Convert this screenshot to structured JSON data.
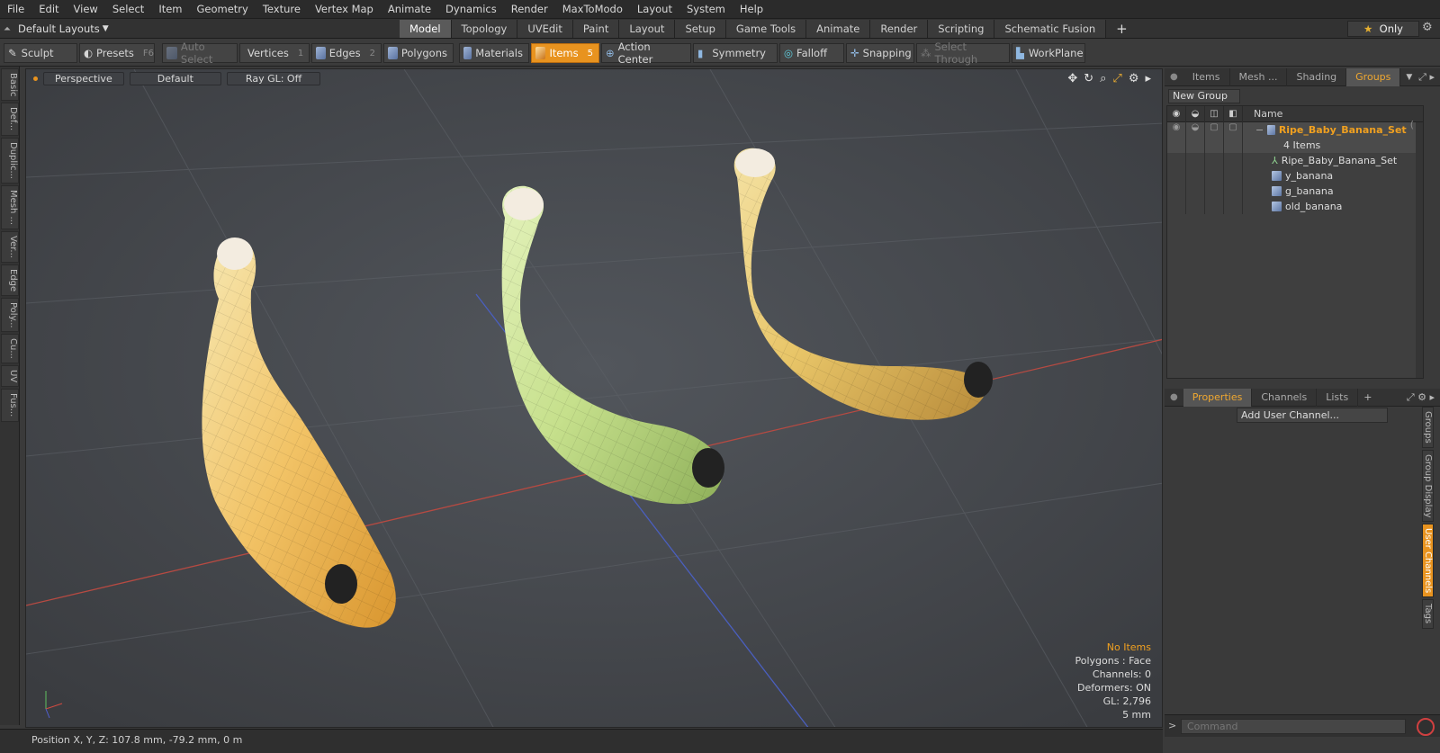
{
  "menu": [
    "File",
    "Edit",
    "View",
    "Select",
    "Item",
    "Geometry",
    "Texture",
    "Vertex Map",
    "Animate",
    "Dynamics",
    "Render",
    "MaxToModo",
    "Layout",
    "System",
    "Help"
  ],
  "layout_selector": "Default Layouts",
  "mode_tabs": [
    {
      "label": "Model",
      "active": true
    },
    {
      "label": "Topology"
    },
    {
      "label": "UVEdit"
    },
    {
      "label": "Paint"
    },
    {
      "label": "Layout"
    },
    {
      "label": "Setup"
    },
    {
      "label": "Game Tools"
    },
    {
      "label": "Animate"
    },
    {
      "label": "Render"
    },
    {
      "label": "Scripting"
    },
    {
      "label": "Schematic Fusion"
    }
  ],
  "only_label": "Only",
  "toolbar": {
    "sculpt": "Sculpt",
    "presets": "Presets",
    "presets_key": "F6",
    "auto_select": "Auto Select",
    "vertices": "Vertices",
    "vertices_key": "1",
    "edges": "Edges",
    "edges_key": "2",
    "polygons": "Polygons",
    "materials": "Materials",
    "items": "Items",
    "items_key": "5",
    "action_center": "Action Center",
    "symmetry": "Symmetry",
    "falloff": "Falloff",
    "snapping": "Snapping",
    "select_through": "Select Through",
    "workplane": "WorkPlane"
  },
  "left_tabs": [
    "Basic",
    "Def...",
    "Duplic...",
    "Mesh ...",
    "Ver...",
    "Edge",
    "Poly...",
    "Cu...",
    "UV",
    "Fus..."
  ],
  "viewport": {
    "view": "Perspective",
    "shading": "Default",
    "raygl": "Ray GL: Off",
    "info": {
      "status": "No Items",
      "polygons": "Polygons : Face",
      "channels": "Channels: 0",
      "deformers": "Deformers: ON",
      "gl": "GL: 2,796",
      "scale": "5 mm"
    }
  },
  "status_bar": "Position X, Y, Z:   107.8 mm, -79.2 mm, 0 m",
  "groups_panel": {
    "tabs": [
      "Items",
      "Mesh ...",
      "Shading",
      "Groups"
    ],
    "new_group": "New Group",
    "name_col": "Name",
    "group_name": "Ripe_Baby_Banana_Set",
    "group_count": "4 Items",
    "children": [
      "Ripe_Baby_Banana_Set",
      "y_banana",
      "g_banana",
      "old_banana"
    ]
  },
  "properties_panel": {
    "tabs": [
      "Properties",
      "Channels",
      "Lists"
    ],
    "add_channel": "Add User Channel...",
    "side_tabs": [
      "Groups",
      "Group Display",
      "User Channels",
      "Tags"
    ]
  },
  "command_placeholder": "Command",
  "colors": {
    "accent": "#e8931f",
    "active_text": "#f0a020"
  }
}
